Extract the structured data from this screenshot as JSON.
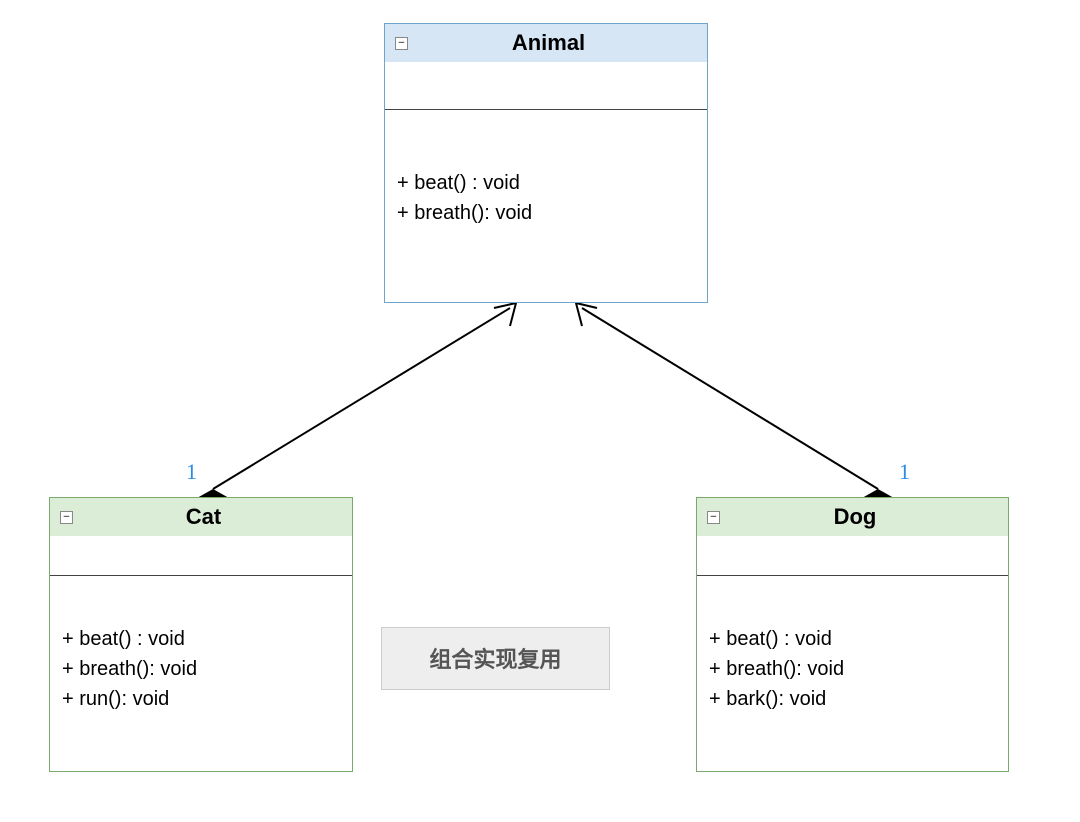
{
  "classes": {
    "animal": {
      "name": "Animal",
      "methods": [
        "+ beat() : void",
        "+ breath(): void"
      ]
    },
    "cat": {
      "name": "Cat",
      "methods": [
        "+ beat() : void",
        "+ breath(): void",
        "+ run(): void"
      ]
    },
    "dog": {
      "name": "Dog",
      "methods": [
        "+ beat() : void",
        "+ breath(): void",
        "+ bark(): void"
      ]
    }
  },
  "note": "组合实现复用",
  "multiplicity": {
    "cat": "1",
    "dog": "1"
  },
  "collapse_glyph": "−",
  "chart_data": {
    "type": "uml_class_diagram",
    "description": "UML class diagram showing composition: Cat and Dog each contain (compose) one Animal",
    "classes": [
      {
        "name": "Animal",
        "methods": [
          "beat(): void",
          "breath(): void"
        ],
        "fill": "#d6e6f5"
      },
      {
        "name": "Cat",
        "methods": [
          "beat(): void",
          "breath(): void",
          "run(): void"
        ],
        "fill": "#dcedd7"
      },
      {
        "name": "Dog",
        "methods": [
          "beat(): void",
          "breath(): void",
          "bark(): void"
        ],
        "fill": "#dcedd7"
      }
    ],
    "relations": [
      {
        "from": "Cat",
        "to": "Animal",
        "type": "composition",
        "multiplicity_near_owner": "1"
      },
      {
        "from": "Dog",
        "to": "Animal",
        "type": "composition",
        "multiplicity_near_owner": "1"
      }
    ],
    "note": "组合实现复用 (reuse via composition)"
  }
}
